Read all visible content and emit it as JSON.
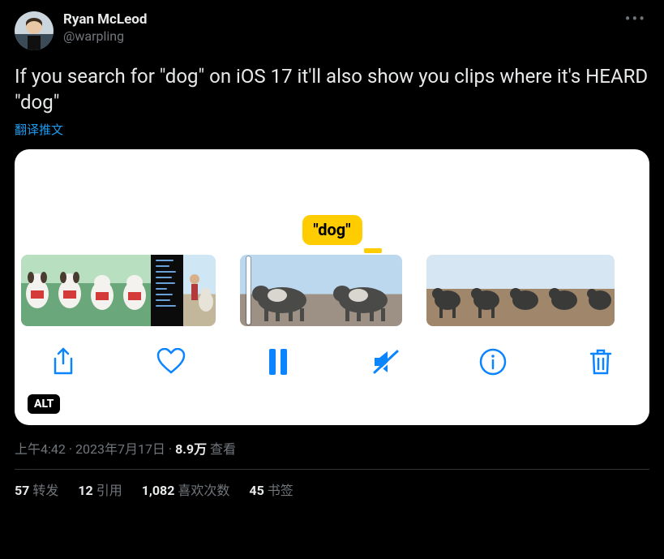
{
  "author": {
    "display_name": "Ryan McLeod",
    "handle": "@warpling"
  },
  "tweet_text": "If you search for \"dog\" on iOS 17 it'll also show you clips where it's HEARD \"dog\"",
  "translate_label": "翻译推文",
  "media": {
    "highlight_label": "\"dog\"",
    "alt_badge": "ALT"
  },
  "meta": {
    "time": "上午4:42",
    "date": "2023年7月17日",
    "views_number": "8.9万",
    "views_label": "查看"
  },
  "stats": {
    "retweets_num": "57",
    "retweets_label": "转发",
    "quotes_num": "12",
    "quotes_label": "引用",
    "likes_num": "1,082",
    "likes_label": "喜欢次数",
    "bookmarks_num": "45",
    "bookmarks_label": "书签"
  }
}
